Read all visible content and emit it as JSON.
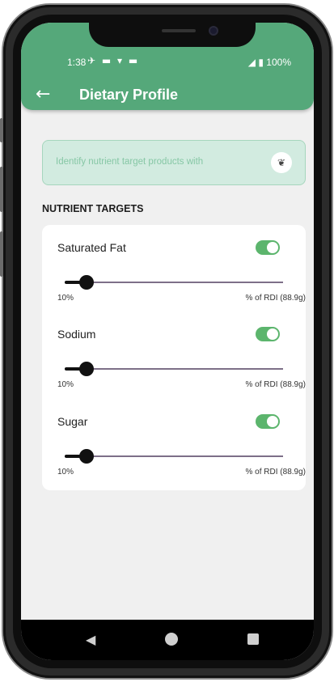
{
  "status_bar": {
    "time": "1:38",
    "left_icons": "✈ ▬ ▾ ▬",
    "right": "◢ ▮ 100%"
  },
  "app_bar": {
    "back_icon": "←",
    "title": "Dietary Profile",
    "color": "#55a87a"
  },
  "banner": {
    "text": "Identify nutrient target products with",
    "icon": "wheat-icon"
  },
  "section": {
    "title": "NUTRIENT TARGETS"
  },
  "targets": [
    {
      "label": "Saturated Fat",
      "enabled": true,
      "value_label": "10%",
      "value_fraction": 0.1,
      "rdi_label": "% of RDI (88.9g)"
    },
    {
      "label": "Sodium",
      "enabled": true,
      "value_label": "10%",
      "value_fraction": 0.1,
      "rdi_label": "% of RDI (88.9g)"
    },
    {
      "label": "Sugar",
      "enabled": true,
      "value_label": "10%",
      "value_fraction": 0.1,
      "rdi_label": "% of RDI (88.9g)"
    }
  ],
  "colors": {
    "accent": "#55a87a",
    "toggle_on": "#5cb56d",
    "banner_bg": "#d2ebe0"
  },
  "nav_bar": {
    "back": "◀"
  }
}
